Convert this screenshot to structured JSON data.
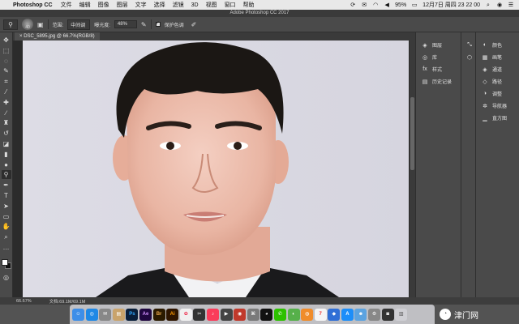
{
  "menubar": {
    "app_name": "Photoshop CC",
    "menus": [
      "文件",
      "编辑",
      "图像",
      "图层",
      "文字",
      "选择",
      "滤镜",
      "3D",
      "视图",
      "窗口",
      "帮助"
    ],
    "battery": "95%",
    "clock": "12月7日 周四 23 22 00"
  },
  "window": {
    "title": "Adobe Photoshop CC 2017"
  },
  "options": {
    "brush_size": "40",
    "range_label": "范围:",
    "range_value": "中间调",
    "exposure_label": "曝光度:",
    "exposure_value": "48%",
    "protect_label": "保护色调"
  },
  "document": {
    "tab_label": "DSC_5895.jpg @ 66.7%(RGB/8)",
    "zoom": "66.67%",
    "doc_size": "文档:69.1M/69.1M"
  },
  "panels": {
    "col1": [
      {
        "icon": "layers-icon",
        "glyph": "◈",
        "label": "图层"
      },
      {
        "icon": "library-icon",
        "glyph": "◎",
        "label": "库"
      },
      {
        "icon": "styles-icon",
        "glyph": "fx",
        "label": "样式"
      },
      {
        "icon": "history-icon",
        "glyph": "▤",
        "label": "历史记录"
      }
    ],
    "col3": [
      {
        "icon": "color-icon",
        "glyph": "◐",
        "label": "颜色"
      },
      {
        "icon": "swatches-icon",
        "glyph": "▦",
        "label": "画笔"
      },
      {
        "icon": "channels-icon",
        "glyph": "◈",
        "label": "通道"
      },
      {
        "icon": "paths-icon",
        "glyph": "◇",
        "label": "路径"
      },
      {
        "icon": "adjustments-icon",
        "glyph": "◑",
        "label": "调整"
      },
      {
        "icon": "navigator-icon",
        "glyph": "✲",
        "label": "导航器"
      },
      {
        "icon": "histogram-icon",
        "glyph": "▁",
        "label": "直方图"
      }
    ]
  },
  "watermark": {
    "text": "津门网"
  },
  "colors": {
    "canvas_bg": "#dcdbe3",
    "ui_dark": "#4a4a4a",
    "dock_ps": "#0a1f3a"
  }
}
